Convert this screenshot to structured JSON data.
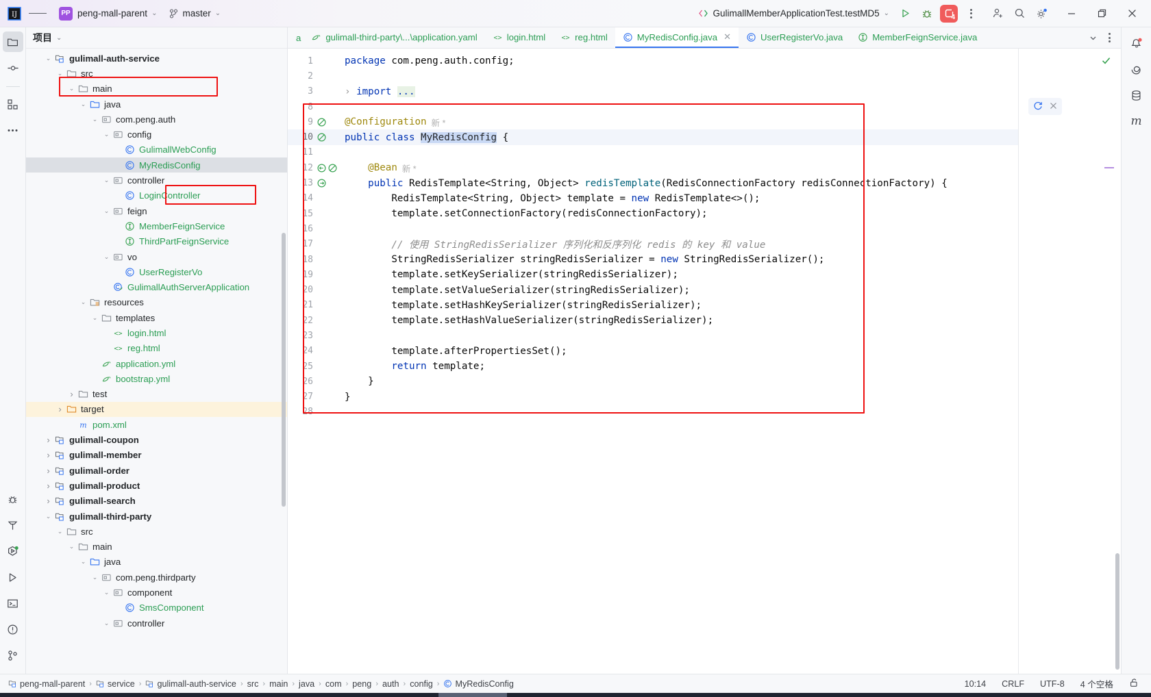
{
  "titlebar": {
    "logo_icon": "intellij-idea-logo",
    "menu_icon": "hamburger-menu-icon",
    "project_badge": "PP",
    "project_name": "peng-mall-parent",
    "branch_icon": "git-branch-icon",
    "branch_name": "master",
    "run_config_icon": "run-config-icon",
    "run_config": "GulimallMemberApplicationTest.testMD5",
    "run_button": "run-icon",
    "debug_button": "debug-icon",
    "problems_count": "4",
    "more_button": "more-options-icon",
    "account_icon": "account-add-icon",
    "search_icon": "search-icon",
    "settings_icon": "gear-icon",
    "minimize": "minimize-icon",
    "maximize": "maximize-icon",
    "close": "close-icon"
  },
  "left_rail": {
    "items": [
      {
        "name": "project-tool-icon",
        "label": "Project",
        "active": true
      },
      {
        "name": "commit-tool-icon",
        "label": "Commit",
        "active": false
      },
      {
        "name": "structure-tool-icon",
        "label": "Structure",
        "active": false
      },
      {
        "name": "more-tools-icon",
        "label": "More",
        "active": false
      }
    ],
    "bottom_items": [
      {
        "name": "debug-tool-icon",
        "label": "Debug"
      },
      {
        "name": "build-tool-icon",
        "label": "Build"
      },
      {
        "name": "services-tool-icon",
        "label": "Services"
      },
      {
        "name": "run-tool-icon",
        "label": "Run"
      },
      {
        "name": "terminal-tool-icon",
        "label": "Terminal"
      },
      {
        "name": "problems-tool-icon",
        "label": "Problems"
      },
      {
        "name": "git-tool-icon",
        "label": "Git"
      }
    ]
  },
  "project_panel": {
    "title": "项目",
    "title_chevron": "chevron-down-icon",
    "tree": [
      {
        "indent": 1,
        "arrow": "down",
        "icon": "module-icon",
        "label": "gulimall-auth-service",
        "style": "bold",
        "boxed": true
      },
      {
        "indent": 2,
        "arrow": "down",
        "icon": "folder-icon",
        "label": "src",
        "style": ""
      },
      {
        "indent": 3,
        "arrow": "down",
        "icon": "folder-icon",
        "label": "main",
        "style": ""
      },
      {
        "indent": 4,
        "arrow": "down",
        "icon": "source-folder-icon",
        "label": "java",
        "style": ""
      },
      {
        "indent": 5,
        "arrow": "down",
        "icon": "package-icon",
        "label": "com.peng.auth",
        "style": ""
      },
      {
        "indent": 6,
        "arrow": "down",
        "icon": "package-icon",
        "label": "config",
        "style": ""
      },
      {
        "indent": 7,
        "arrow": "none",
        "icon": "class-icon",
        "label": "GulimallWebConfig",
        "style": "green"
      },
      {
        "indent": 7,
        "arrow": "none",
        "icon": "class-icon",
        "label": "MyRedisConfig",
        "style": "green",
        "selected": true,
        "boxed": true
      },
      {
        "indent": 6,
        "arrow": "down",
        "icon": "package-icon",
        "label": "controller",
        "style": ""
      },
      {
        "indent": 7,
        "arrow": "none",
        "icon": "class-icon",
        "label": "LoginController",
        "style": "green"
      },
      {
        "indent": 6,
        "arrow": "down",
        "icon": "package-icon",
        "label": "feign",
        "style": ""
      },
      {
        "indent": 7,
        "arrow": "none",
        "icon": "interface-icon",
        "label": "MemberFeignService",
        "style": "green"
      },
      {
        "indent": 7,
        "arrow": "none",
        "icon": "interface-icon",
        "label": "ThirdPartFeignService",
        "style": "green"
      },
      {
        "indent": 6,
        "arrow": "down",
        "icon": "package-icon",
        "label": "vo",
        "style": ""
      },
      {
        "indent": 7,
        "arrow": "none",
        "icon": "class-icon",
        "label": "UserRegisterVo",
        "style": "green"
      },
      {
        "indent": 6,
        "arrow": "none",
        "icon": "spring-class-icon",
        "label": "GulimallAuthServerApplication",
        "style": "green"
      },
      {
        "indent": 4,
        "arrow": "down",
        "icon": "resources-folder-icon",
        "label": "resources",
        "style": ""
      },
      {
        "indent": 5,
        "arrow": "down",
        "icon": "folder-icon",
        "label": "templates",
        "style": ""
      },
      {
        "indent": 6,
        "arrow": "none",
        "icon": "html-file-icon",
        "label": "login.html",
        "style": "green"
      },
      {
        "indent": 6,
        "arrow": "none",
        "icon": "html-file-icon",
        "label": "reg.html",
        "style": "green"
      },
      {
        "indent": 5,
        "arrow": "none",
        "icon": "yaml-file-icon",
        "label": "application.yml",
        "style": "green"
      },
      {
        "indent": 5,
        "arrow": "none",
        "icon": "yaml-file-icon",
        "label": "bootstrap.yml",
        "style": "green"
      },
      {
        "indent": 3,
        "arrow": "right",
        "icon": "folder-icon",
        "label": "test",
        "style": ""
      },
      {
        "indent": 2,
        "arrow": "right",
        "icon": "excluded-folder-icon",
        "label": "target",
        "style": "",
        "yellow": true
      },
      {
        "indent": 3,
        "arrow": "none",
        "icon": "maven-file-icon",
        "label": "pom.xml",
        "style": "green"
      },
      {
        "indent": 1,
        "arrow": "right",
        "icon": "module-icon",
        "label": "gulimall-coupon",
        "style": "bold"
      },
      {
        "indent": 1,
        "arrow": "right",
        "icon": "module-icon",
        "label": "gulimall-member",
        "style": "bold"
      },
      {
        "indent": 1,
        "arrow": "right",
        "icon": "module-icon",
        "label": "gulimall-order",
        "style": "bold"
      },
      {
        "indent": 1,
        "arrow": "right",
        "icon": "module-icon",
        "label": "gulimall-product",
        "style": "bold"
      },
      {
        "indent": 1,
        "arrow": "right",
        "icon": "module-icon",
        "label": "gulimall-search",
        "style": "bold"
      },
      {
        "indent": 1,
        "arrow": "down",
        "icon": "module-icon",
        "label": "gulimall-third-party",
        "style": "bold"
      },
      {
        "indent": 2,
        "arrow": "down",
        "icon": "folder-icon",
        "label": "src",
        "style": ""
      },
      {
        "indent": 3,
        "arrow": "down",
        "icon": "folder-icon",
        "label": "main",
        "style": ""
      },
      {
        "indent": 4,
        "arrow": "down",
        "icon": "source-folder-icon",
        "label": "java",
        "style": ""
      },
      {
        "indent": 5,
        "arrow": "down",
        "icon": "package-icon",
        "label": "com.peng.thirdparty",
        "style": ""
      },
      {
        "indent": 6,
        "arrow": "down",
        "icon": "package-icon",
        "label": "component",
        "style": ""
      },
      {
        "indent": 7,
        "arrow": "none",
        "icon": "class-icon",
        "label": "SmsComponent",
        "style": "green"
      },
      {
        "indent": 6,
        "arrow": "down",
        "icon": "package-icon",
        "label": "controller",
        "style": ""
      }
    ]
  },
  "editor_tabs": {
    "partial_tab": "a",
    "tabs": [
      {
        "icon": "yaml-file-icon",
        "label": "gulimall-third-party\\...\\application.yaml",
        "color": "green",
        "active": false,
        "closable": false
      },
      {
        "icon": "html-file-icon",
        "label": "login.html",
        "color": "green",
        "active": false,
        "closable": false
      },
      {
        "icon": "html-file-icon",
        "label": "reg.html",
        "color": "green",
        "active": false,
        "closable": false
      },
      {
        "icon": "class-icon",
        "label": "MyRedisConfig.java",
        "color": "green",
        "active": true,
        "closable": true
      },
      {
        "icon": "class-icon",
        "label": "UserRegisterVo.java",
        "color": "green",
        "active": false,
        "closable": false
      },
      {
        "icon": "interface-icon",
        "label": "MemberFeignService.java",
        "color": "green",
        "active": false,
        "closable": false
      }
    ],
    "chevron_icon": "chevron-down-icon",
    "more_icon": "more-options-icon"
  },
  "editor": {
    "inspection_status_icon": "inspections-ok-icon",
    "hint_chip_icon": "refresh-icon",
    "hint_chip_close": "close-icon",
    "lines": [
      {
        "num": "1",
        "gutter": [],
        "segments": [
          {
            "t": "package ",
            "c": "kw"
          },
          {
            "t": "com.peng.auth.config;",
            "c": "plain"
          }
        ]
      },
      {
        "num": "2",
        "gutter": [],
        "segments": []
      },
      {
        "num": "3",
        "gutter": [],
        "fold": true,
        "segments": [
          {
            "t": "import ",
            "c": "kw"
          },
          {
            "t": "...",
            "c": "importdots"
          }
        ]
      },
      {
        "num": "8",
        "gutter": [],
        "segments": []
      },
      {
        "num": "9",
        "gutter": [
          "bean-gutter-icon"
        ],
        "segments": [
          {
            "t": "@Configuration",
            "c": "ann"
          },
          {
            "t": "  新 *",
            "c": "hintgray"
          }
        ]
      },
      {
        "num": "10",
        "gutter": [
          "bean-gutter-icon"
        ],
        "current": true,
        "segments": [
          {
            "t": "public class ",
            "c": "kw"
          },
          {
            "t": "MyRedisConfig",
            "c": "caretsel"
          },
          {
            "t": " {",
            "c": "plain"
          }
        ]
      },
      {
        "num": "11",
        "gutter": [],
        "segments": []
      },
      {
        "num": "12",
        "gutter": [
          "navigate-gutter-icon",
          "bean-gutter-icon"
        ],
        "segments": [
          {
            "t": "    @Bean",
            "c": "ann"
          },
          {
            "t": "  新 *",
            "c": "hintgray"
          }
        ]
      },
      {
        "num": "13",
        "gutter": [
          "bean-arrow-gutter-icon"
        ],
        "segments": [
          {
            "t": "    public ",
            "c": "kw"
          },
          {
            "t": "RedisTemplate<String, Object> ",
            "c": "plain"
          },
          {
            "t": "redisTemplate",
            "c": "mth"
          },
          {
            "t": "(RedisConnectionFactory redisConnectionFactory) {",
            "c": "plain"
          }
        ]
      },
      {
        "num": "14",
        "gutter": [],
        "segments": [
          {
            "t": "        RedisTemplate<String, Object> template = ",
            "c": "plain"
          },
          {
            "t": "new ",
            "c": "kw"
          },
          {
            "t": "RedisTemplate<>();",
            "c": "plain"
          }
        ]
      },
      {
        "num": "15",
        "gutter": [],
        "segments": [
          {
            "t": "        template.setConnectionFactory(redisConnectionFactory);",
            "c": "plain"
          }
        ]
      },
      {
        "num": "16",
        "gutter": [],
        "segments": []
      },
      {
        "num": "17",
        "gutter": [],
        "segments": [
          {
            "t": "        // 使用 StringRedisSerializer 序列化和反序列化 redis 的 key 和 value",
            "c": "cmt"
          }
        ]
      },
      {
        "num": "18",
        "gutter": [],
        "segments": [
          {
            "t": "        StringRedisSerializer stringRedisSerializer = ",
            "c": "plain"
          },
          {
            "t": "new ",
            "c": "kw"
          },
          {
            "t": "StringRedisSerializer();",
            "c": "plain"
          }
        ]
      },
      {
        "num": "19",
        "gutter": [],
        "segments": [
          {
            "t": "        template.setKeySerializer(stringRedisSerializer);",
            "c": "plain"
          }
        ]
      },
      {
        "num": "20",
        "gutter": [],
        "segments": [
          {
            "t": "        template.setValueSerializer(stringRedisSerializer);",
            "c": "plain"
          }
        ]
      },
      {
        "num": "21",
        "gutter": [],
        "segments": [
          {
            "t": "        template.setHashKeySerializer(stringRedisSerializer);",
            "c": "plain"
          }
        ]
      },
      {
        "num": "22",
        "gutter": [],
        "segments": [
          {
            "t": "        template.setHashValueSerializer(stringRedisSerializer);",
            "c": "plain"
          }
        ]
      },
      {
        "num": "23",
        "gutter": [],
        "segments": []
      },
      {
        "num": "24",
        "gutter": [],
        "segments": [
          {
            "t": "        template.afterPropertiesSet();",
            "c": "plain"
          }
        ]
      },
      {
        "num": "25",
        "gutter": [],
        "segments": [
          {
            "t": "        return ",
            "c": "kw"
          },
          {
            "t": "template;",
            "c": "plain"
          }
        ]
      },
      {
        "num": "26",
        "gutter": [],
        "segments": [
          {
            "t": "    }",
            "c": "plain"
          }
        ]
      },
      {
        "num": "27",
        "gutter": [],
        "segments": [
          {
            "t": "}",
            "c": "plain"
          }
        ]
      },
      {
        "num": "28",
        "gutter": [],
        "segments": []
      }
    ]
  },
  "right_rail": {
    "items": [
      {
        "name": "notifications-icon",
        "label": "Notifications",
        "badge": true
      },
      {
        "name": "ai-assistant-icon",
        "label": "AI Assistant",
        "badge": false
      },
      {
        "name": "database-icon",
        "label": "Database",
        "badge": false
      },
      {
        "name": "maven-icon",
        "label": "Maven",
        "badge": false
      }
    ]
  },
  "statusbar": {
    "breadcrumbs": [
      {
        "icon": "module-icon",
        "label": "peng-mall-parent"
      },
      {
        "icon": "module-icon",
        "label": "service"
      },
      {
        "icon": "module-icon",
        "label": "gulimall-auth-service"
      },
      {
        "icon": "",
        "label": "src"
      },
      {
        "icon": "",
        "label": "main"
      },
      {
        "icon": "",
        "label": "java"
      },
      {
        "icon": "",
        "label": "com"
      },
      {
        "icon": "",
        "label": "peng"
      },
      {
        "icon": "",
        "label": "auth"
      },
      {
        "icon": "",
        "label": "config"
      },
      {
        "icon": "class-icon",
        "label": "MyRedisConfig"
      }
    ],
    "caret_position": "10:14",
    "line_separator": "CRLF",
    "encoding": "UTF-8",
    "indent": "4 个空格",
    "lock_icon": "unlocked-icon"
  },
  "colors": {
    "accent_blue": "#3574f0",
    "annotation_red": "#ee1111",
    "green_text": "#2a9d53",
    "keyword_blue": "#0033b3",
    "purple_badge": "#9f52e0",
    "error_red": "#f05b5b"
  }
}
